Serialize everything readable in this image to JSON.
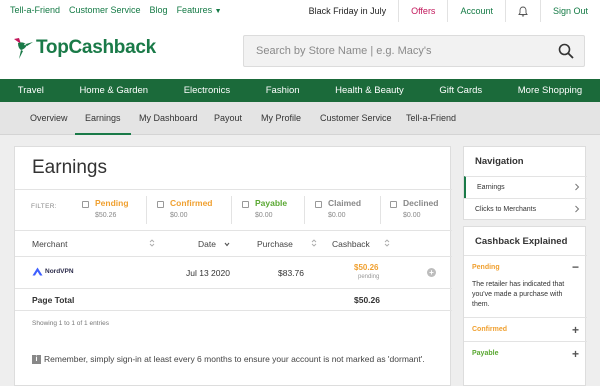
{
  "topbar": {
    "left_links": [
      "Tell-a-Friend",
      "Customer Service",
      "Blog"
    ],
    "features_label": "Features",
    "promo": "Black Friday in July",
    "offers": "Offers",
    "account": "Account",
    "signout": "Sign Out"
  },
  "header": {
    "logo_text": "TopCashback",
    "search_placeholder": "Search by Store Name | e.g. Macy's"
  },
  "main_nav": [
    "Travel",
    "Home & Garden",
    "Electronics",
    "Fashion",
    "Health & Beauty",
    "Gift Cards",
    "More Shopping"
  ],
  "sub_nav": {
    "items": [
      "Overview",
      "Earnings",
      "My Dashboard",
      "Payout",
      "My Profile",
      "Customer Service",
      "Tell-a-Friend"
    ],
    "active": "Earnings"
  },
  "earnings": {
    "title": "Earnings",
    "filter_label": "FILTER:",
    "filters": [
      {
        "name": "Pending",
        "amount": "$50.26",
        "color": "#f0a030"
      },
      {
        "name": "Confirmed",
        "amount": "$0.00",
        "color": "#f0a030"
      },
      {
        "name": "Payable",
        "amount": "$0.00",
        "color": "#5aa832"
      },
      {
        "name": "Claimed",
        "amount": "$0.00",
        "color": "#888888"
      },
      {
        "name": "Declined",
        "amount": "$0.00",
        "color": "#888888"
      }
    ],
    "columns": {
      "merchant": "Merchant",
      "date": "Date",
      "purchase": "Purchase",
      "cashback": "Cashback"
    },
    "rows": [
      {
        "merchant": "NordVPN",
        "date": "Jul 13 2020",
        "purchase": "$83.76",
        "cashback": "$50.26",
        "status": "pending"
      }
    ],
    "page_total_label": "Page Total",
    "page_total": "$50.26",
    "showing": "Showing 1 to 1 of 1 entries",
    "reminder": "Remember, simply sign-in at least every 6 months to ensure your account is not marked as 'dormant'."
  },
  "navigation": {
    "title": "Navigation",
    "items": [
      "Earnings",
      "Clicks to Merchants"
    ]
  },
  "cashback_explained": {
    "title": "Cashback Explained",
    "sections": [
      {
        "name": "Pending",
        "desc": "The retailer has indicated that you've made a purchase with them.",
        "color": "#f0a030",
        "expanded": true
      },
      {
        "name": "Confirmed",
        "color": "#f0a030",
        "expanded": false
      },
      {
        "name": "Payable",
        "color": "#5aa832",
        "expanded": false
      }
    ]
  },
  "colors": {
    "brand_green": "#1b6a3a",
    "accent_orange": "#f0a030",
    "offers_pink": "#c2185b"
  }
}
